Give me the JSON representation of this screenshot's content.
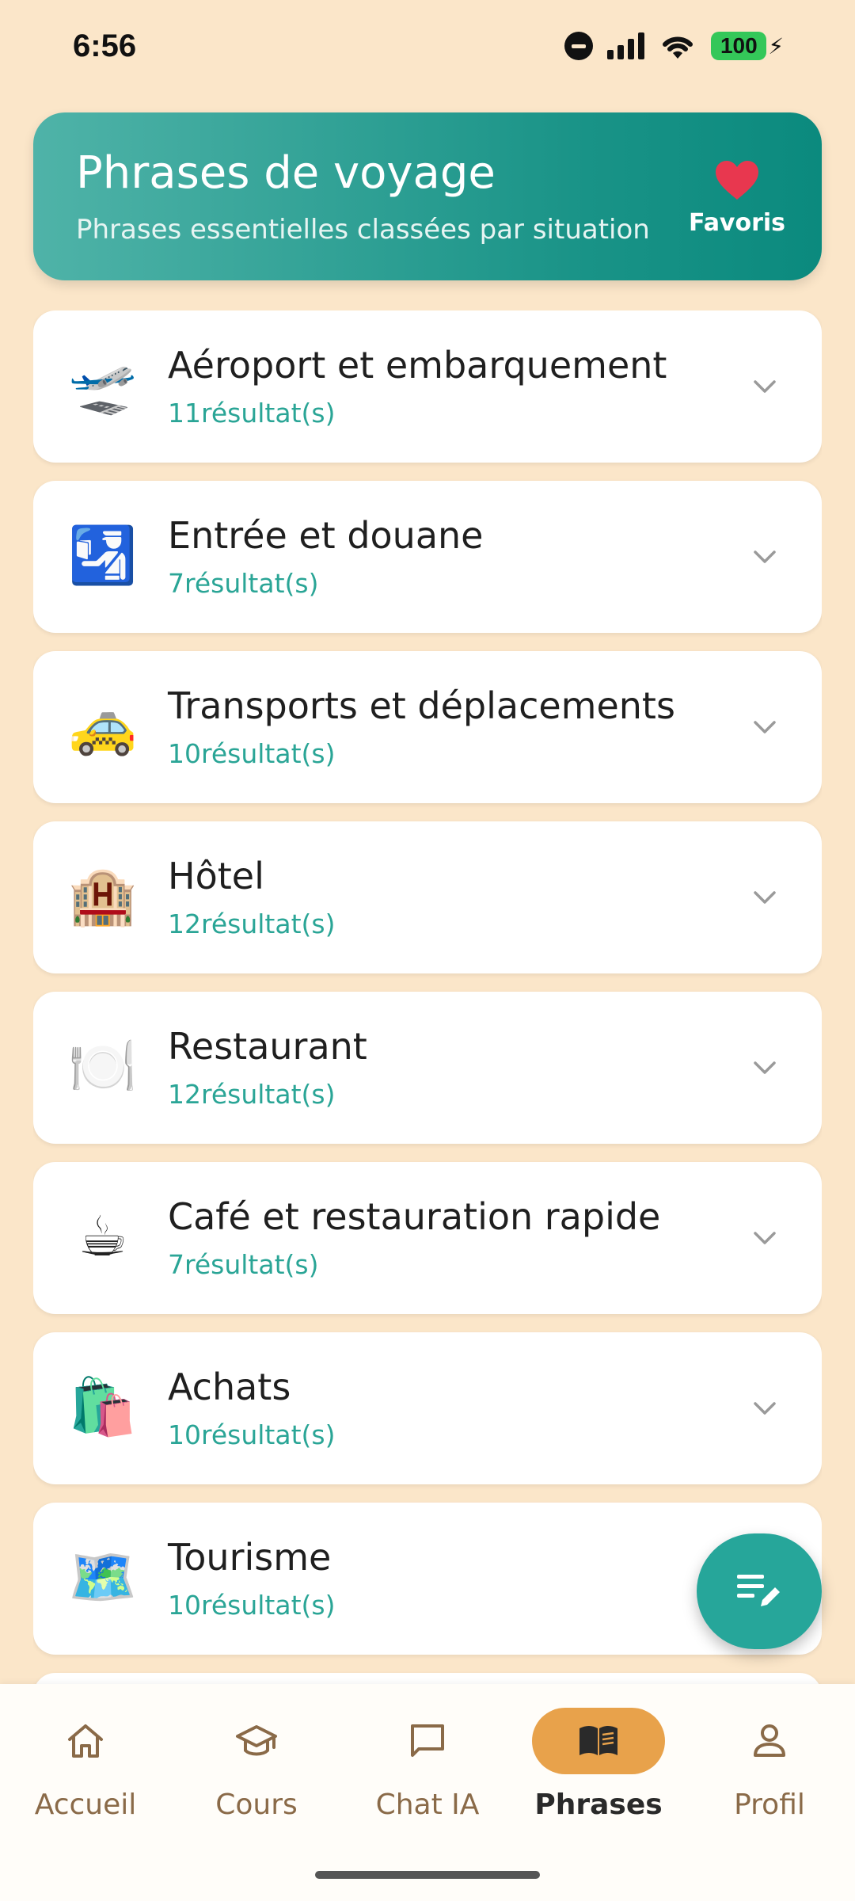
{
  "status_bar": {
    "time": "6:56",
    "battery": "100"
  },
  "header": {
    "title": "Phrases de voyage",
    "subtitle": "Phrases essentielles classées par situation",
    "favorites_label": "Favoris"
  },
  "categories": [
    {
      "icon": "airplane-departure-icon",
      "emoji": "🛫",
      "title": "Aéroport et embarquement",
      "count": "11résultat(s)"
    },
    {
      "icon": "passport-control-icon",
      "emoji": "🛂",
      "title": "Entrée et douane",
      "count": "7résultat(s)"
    },
    {
      "icon": "taxi-icon",
      "emoji": "🚕",
      "title": "Transports et déplacements",
      "count": "10résultat(s)"
    },
    {
      "icon": "hotel-icon",
      "emoji": "🏨",
      "title": "Hôtel",
      "count": "12résultat(s)"
    },
    {
      "icon": "plate-cutlery-icon",
      "emoji": "🍽️",
      "title": "Restaurant",
      "count": "12résultat(s)"
    },
    {
      "icon": "hot-beverage-icon",
      "emoji": "☕",
      "title": "Café et restauration rapide",
      "count": "7résultat(s)"
    },
    {
      "icon": "shopping-bags-icon",
      "emoji": "🛍️",
      "title": "Achats",
      "count": "10résultat(s)"
    },
    {
      "icon": "world-map-icon",
      "emoji": "🗺️",
      "title": "Tourisme",
      "count": "10résultat(s)"
    }
  ],
  "nav": {
    "items": [
      {
        "label": "Accueil",
        "icon": "home-icon",
        "active": false
      },
      {
        "label": "Cours",
        "icon": "graduation-cap-icon",
        "active": false
      },
      {
        "label": "Chat IA",
        "icon": "chat-bubble-icon",
        "active": false
      },
      {
        "label": "Phrases",
        "icon": "book-icon",
        "active": true
      },
      {
        "label": "Profil",
        "icon": "person-icon",
        "active": false
      }
    ]
  },
  "colors": {
    "background": "#fbe6c9",
    "header_gradient_start": "#4fb3a8",
    "header_gradient_end": "#0b8a7e",
    "count_text": "#2aa596",
    "active_nav": "#e8a24b",
    "fab": "#26a69a",
    "heart": "#e8374f"
  }
}
